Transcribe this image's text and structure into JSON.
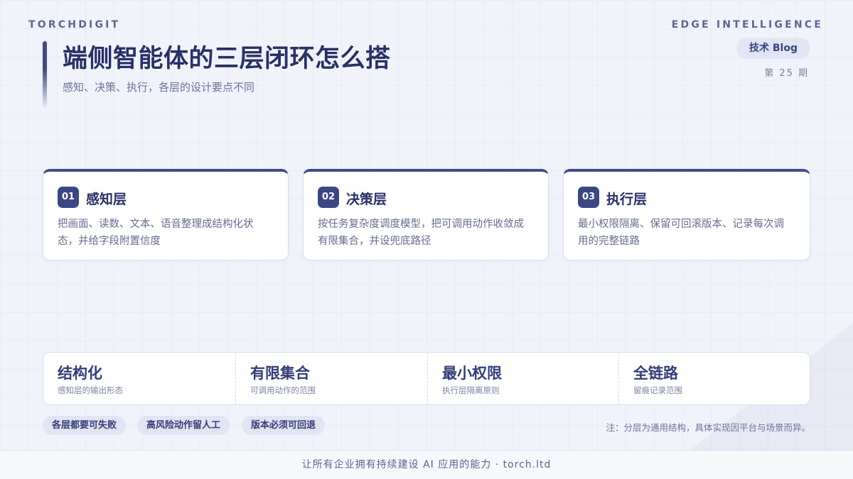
{
  "brand": {
    "left": "TORCHDIGIT",
    "right": "EDGE INTELLIGENCE"
  },
  "header": {
    "title": "端侧智能体的三层闭环怎么搭",
    "subtitle": "感知、决策、执行，各层的设计要点不同",
    "tag": "技术 Blog",
    "issue": "第 25 期"
  },
  "cards": [
    {
      "num": "01",
      "name": "感知层",
      "desc": "把画面、读数、文本、语音整理成结构化状态，并给字段附置信度"
    },
    {
      "num": "02",
      "name": "决策层",
      "desc": "按任务复杂度调度模型，把可调用动作收敛成有限集合，并设兜底路径"
    },
    {
      "num": "03",
      "name": "执行层",
      "desc": "最小权限隔离、保留可回滚版本、记录每次调用的完整链路"
    }
  ],
  "stats": [
    {
      "big": "结构化",
      "small": "感知层的输出形态"
    },
    {
      "big": "有限集合",
      "small": "可调用动作的范围"
    },
    {
      "big": "最小权限",
      "small": "执行层隔离原则"
    },
    {
      "big": "全链路",
      "small": "留痕记录范围"
    }
  ],
  "pills": [
    "各层都要可失败",
    "高风险动作留人工",
    "版本必须可回退"
  ],
  "note": "注：分层为通用结构，具体实现因平台与场景而异。",
  "footer": "让所有企业拥有持续建设 AI 应用的能力 · torch.ltd",
  "colors": {
    "accent": "#3b4683",
    "title": "#283068",
    "background": "#f1f3fa"
  }
}
